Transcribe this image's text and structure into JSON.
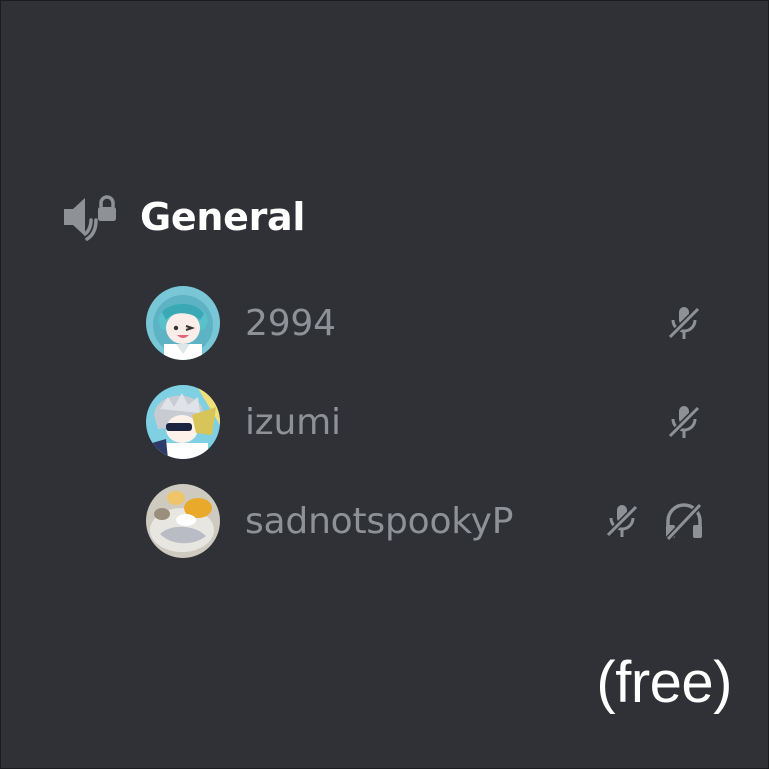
{
  "channel": {
    "name": "General",
    "icon": "locked-voice-channel-icon"
  },
  "members": [
    {
      "name": "2994",
      "avatar": "anime-avatar-teal-hair",
      "status_icons": [
        "mic-muted-icon"
      ]
    },
    {
      "name": "izumi",
      "avatar": "anime-avatar-grey-hair",
      "status_icons": [
        "mic-muted-icon"
      ]
    },
    {
      "name": "sadnotspookyP",
      "avatar": "photo-avatar-food",
      "status_icons": [
        "mic-muted-icon",
        "headphones-deafened-icon"
      ]
    }
  ],
  "footer": {
    "label": "(free)"
  },
  "colors": {
    "background": "#2f3136",
    "channel_text": "#ffffff",
    "member_text": "#8e9297",
    "icon": "#8e9297"
  }
}
